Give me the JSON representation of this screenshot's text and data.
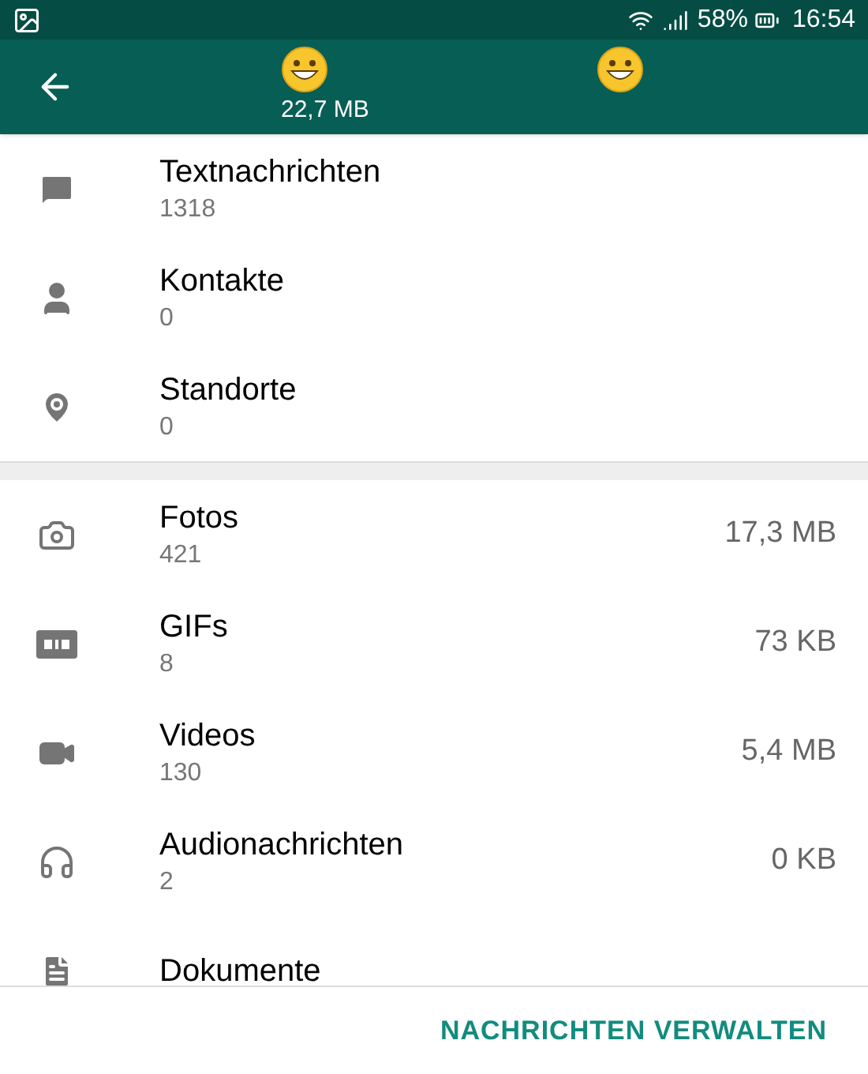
{
  "status_bar": {
    "battery": "58%",
    "time": "16:54"
  },
  "header": {
    "subtitle": "22,7 MB"
  },
  "sections": [
    {
      "items": [
        {
          "kind": "messages",
          "label": "Textnachrichten",
          "count": "1318"
        },
        {
          "kind": "contacts",
          "label": "Kontakte",
          "count": "0"
        },
        {
          "kind": "locations",
          "label": "Standorte",
          "count": "0"
        }
      ]
    },
    {
      "items": [
        {
          "kind": "photos",
          "label": "Fotos",
          "count": "421",
          "size": "17,3 MB"
        },
        {
          "kind": "gifs",
          "label": "GIFs",
          "count": "8",
          "size": "73 KB"
        },
        {
          "kind": "videos",
          "label": "Videos",
          "count": "130",
          "size": "5,4 MB"
        },
        {
          "kind": "audio",
          "label": "Audionachrichten",
          "count": "2",
          "size": "0 KB"
        },
        {
          "kind": "documents",
          "label": "Dokumente"
        }
      ]
    }
  ],
  "action": "NACHRICHTEN VERWALTEN"
}
